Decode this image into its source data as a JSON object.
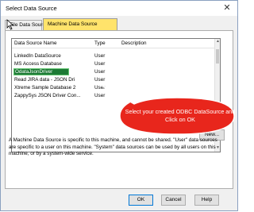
{
  "window": {
    "title": "Select Data Source",
    "close_glyph": "✕"
  },
  "tabs": [
    {
      "label": "File Data Source",
      "active": false
    },
    {
      "label": "Machine Data Source",
      "active": true,
      "highlight_color": "#ffe36b"
    }
  ],
  "list": {
    "columns": [
      "Data Source Name",
      "Type",
      "Description"
    ],
    "rows": [
      {
        "name": "LinkedIn DataSource",
        "type": "User"
      },
      {
        "name": "MS Access Database",
        "type": "User"
      },
      {
        "name": "OdataJsonDriver",
        "type": "User",
        "selected": true
      },
      {
        "name": "Read JIRA data - JSON Dri",
        "type": "User"
      },
      {
        "name": "Xtreme Sample Database 2",
        "type": "User"
      },
      {
        "name": "ZappySys JSON Driver Con...",
        "type": "User"
      }
    ]
  },
  "buttons": {
    "new": "New...",
    "ok": "OK",
    "cancel": "Cancel",
    "help": "Help"
  },
  "description": "A Machine Data Source is specific to this machine, and cannot be shared. \"User\" data sources are specific to a user on this machine.  \"System\" data sources can be used by all users on this machine, or by a system-wide service.",
  "callout": {
    "text": "Select your created ODBC DataSource and Click on OK",
    "color": "#e8261c"
  },
  "colors": {
    "selection": "#1d7a35",
    "accent": "#0078d7"
  }
}
